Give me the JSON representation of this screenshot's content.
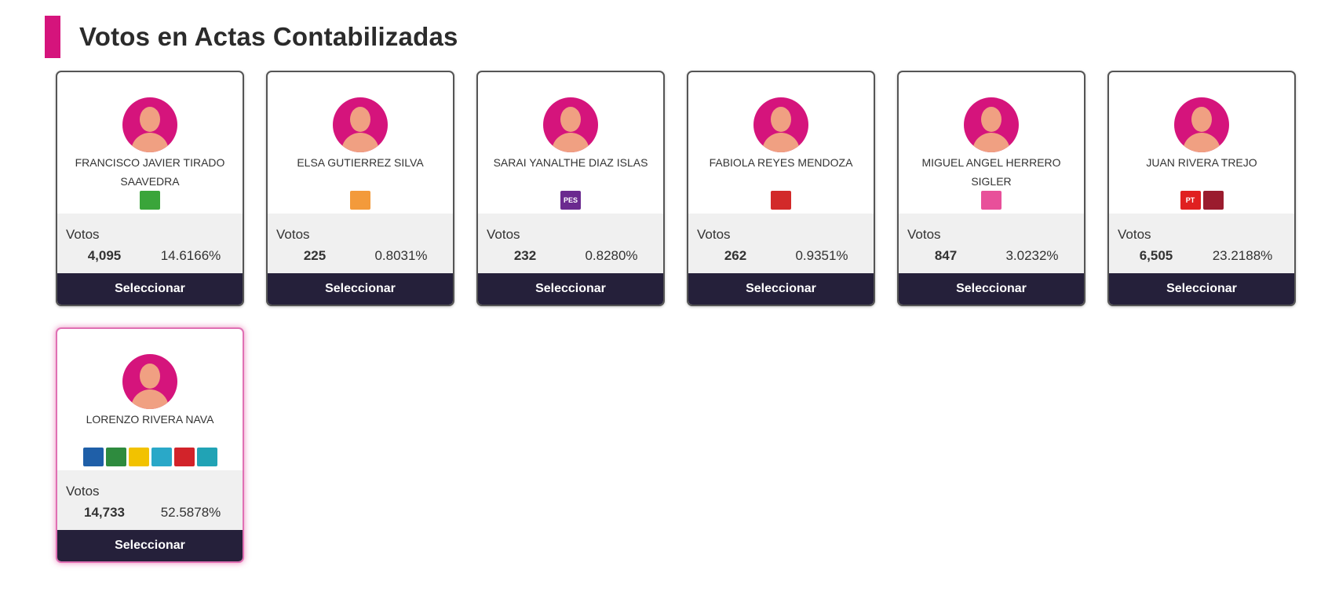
{
  "header": {
    "title": "Votos en Actas Contabilizadas"
  },
  "votes_label": "Votos",
  "select_label": "Seleccionar",
  "candidates": [
    {
      "name": "FRANCISCO JAVIER TIRADO SAAVEDRA",
      "votes": "4,095",
      "percent": "14.6166%",
      "logos": [
        {
          "icon": "pvem-logo",
          "color": "#3aa53a",
          "text": ""
        }
      ]
    },
    {
      "name": "ELSA GUTIERREZ SILVA",
      "votes": "225",
      "percent": "0.8031%",
      "logos": [
        {
          "icon": "movimiento-ciudadano-logo",
          "color": "#f39a3b",
          "text": ""
        }
      ]
    },
    {
      "name": "SARAI YANALTHE DIAZ ISLAS",
      "votes": "232",
      "percent": "0.8280%",
      "logos": [
        {
          "icon": "pes-logo",
          "color": "#6b2a8f",
          "text": "PES"
        }
      ]
    },
    {
      "name": "FABIOLA REYES MENDOZA",
      "votes": "262",
      "percent": "0.9351%",
      "logos": [
        {
          "icon": "rsp-logo",
          "color": "#d22a2a",
          "text": ""
        }
      ]
    },
    {
      "name": "MIGUEL ANGEL HERRERO SIGLER",
      "votes": "847",
      "percent": "3.0232%",
      "logos": [
        {
          "icon": "fuerza-mexico-logo",
          "color": "#e8509a",
          "text": ""
        }
      ]
    },
    {
      "name": "JUAN RIVERA TREJO",
      "votes": "6,505",
      "percent": "23.2188%",
      "logos": [
        {
          "icon": "pt-logo",
          "color": "#e02020",
          "text": "PT"
        },
        {
          "icon": "morena-logo",
          "color": "#9b1c2e",
          "text": ""
        }
      ]
    },
    {
      "name": "LORENZO RIVERA NAVA",
      "votes": "14,733",
      "percent": "52.5878%",
      "logos": [
        {
          "icon": "pan-logo",
          "color": "#1f5fa8",
          "text": ""
        },
        {
          "icon": "pri-logo",
          "color": "#2e8b3e",
          "text": ""
        },
        {
          "icon": "prd-logo",
          "color": "#f2c200",
          "text": ""
        },
        {
          "icon": "nueva-alianza-logo",
          "color": "#2aa8c8",
          "text": ""
        },
        {
          "icon": "psi-logo",
          "color": "#d2232a",
          "text": ""
        },
        {
          "icon": "compromiso-logo",
          "color": "#21a3b5",
          "text": ""
        }
      ]
    }
  ]
}
